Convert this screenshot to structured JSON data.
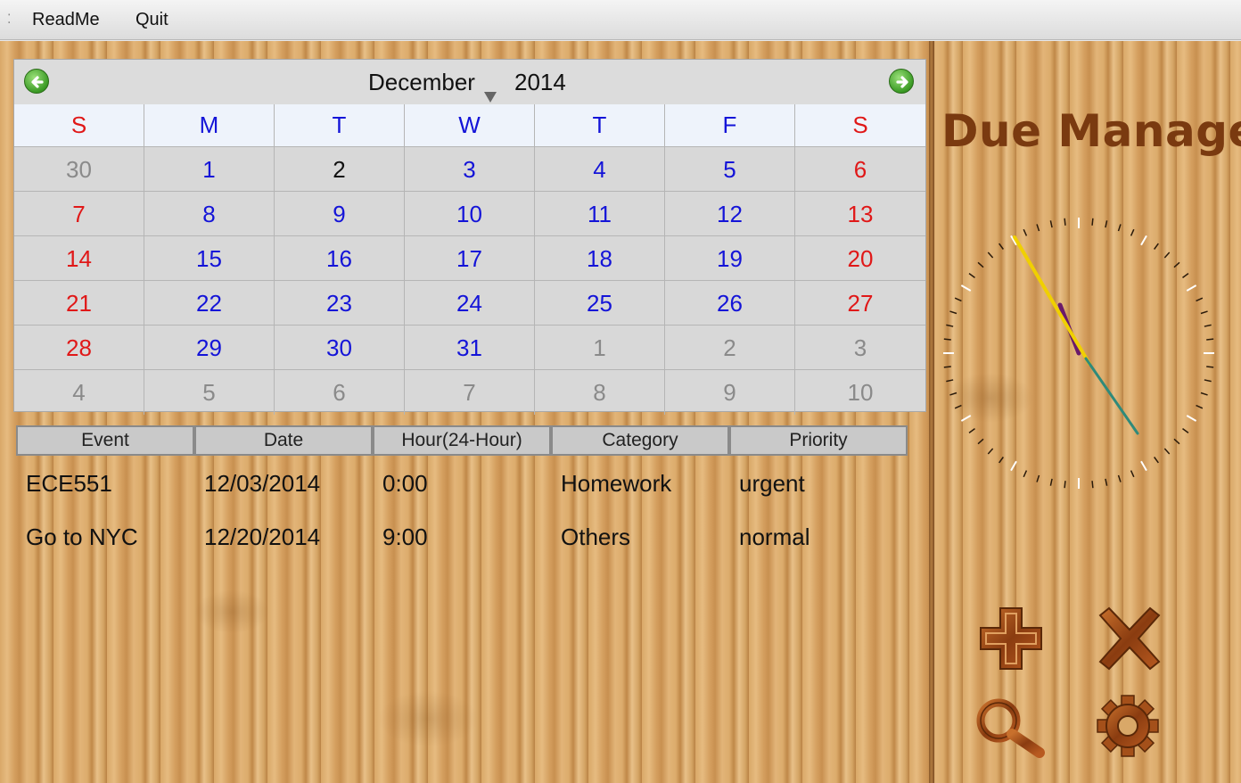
{
  "menubar": {
    "items": [
      "ReadMe",
      "Quit"
    ]
  },
  "calendar": {
    "month": "December",
    "year": "2014",
    "weekdays": [
      "S",
      "M",
      "T",
      "W",
      "T",
      "F",
      "S"
    ],
    "weeks": [
      [
        "30",
        "1",
        "2",
        "3",
        "4",
        "5",
        "6"
      ],
      [
        "7",
        "8",
        "9",
        "10",
        "11",
        "12",
        "13"
      ],
      [
        "14",
        "15",
        "16",
        "17",
        "18",
        "19",
        "20"
      ],
      [
        "21",
        "22",
        "23",
        "24",
        "25",
        "26",
        "27"
      ],
      [
        "28",
        "29",
        "30",
        "31",
        "1",
        "2",
        "3"
      ],
      [
        "4",
        "5",
        "6",
        "7",
        "8",
        "9",
        "10"
      ]
    ],
    "prev_icon": "left-arrow-icon",
    "next_icon": "right-arrow-icon",
    "colors": {
      "weekday": "#1414d8",
      "weekend": "#e01818",
      "other_month": "#8a8a8a",
      "selected": "#111111"
    }
  },
  "events": {
    "columns": [
      "Event",
      "Date",
      "Hour(24-Hour)",
      "Category",
      "Priority"
    ],
    "rows": [
      [
        "ECE551",
        "12/03/2014",
        "0:00",
        "Homework",
        "urgent"
      ],
      [
        "Go to NYC",
        "12/20/2014",
        "9:00",
        "Others",
        "normal"
      ]
    ]
  },
  "app": {
    "title": "Due Manager",
    "title_color": "#7a3a10",
    "actions": [
      {
        "name": "add-button",
        "icon": "plus-icon"
      },
      {
        "name": "delete-button",
        "icon": "cross-icon"
      },
      {
        "name": "search-button",
        "icon": "magnifier-icon"
      },
      {
        "name": "settings-button",
        "icon": "gear-icon"
      }
    ]
  }
}
